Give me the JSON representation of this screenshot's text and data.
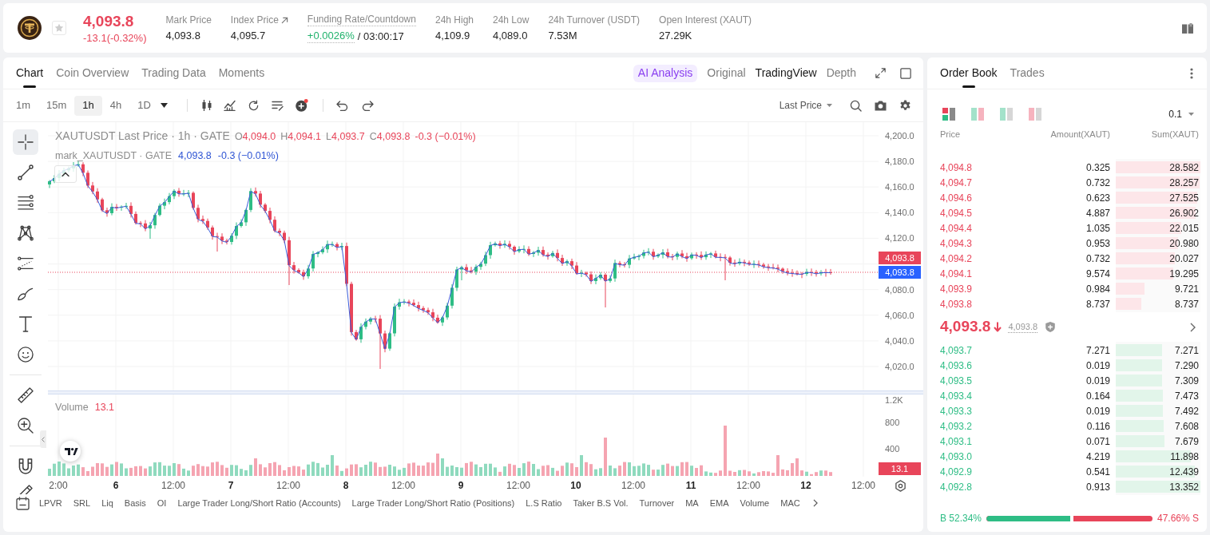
{
  "header": {
    "price": "4,093.8",
    "change": "-13.1(-0.32%)",
    "favorite": false,
    "stats": [
      {
        "label": "Mark Price",
        "value": "4,093.8",
        "kind": "plain"
      },
      {
        "label": "Index Price",
        "value": "4,095.7",
        "kind": "link"
      },
      {
        "label": "Funding Rate/Countdown",
        "value": "+0.0026%",
        "extra": "/ 03:00:17",
        "kind": "funding"
      },
      {
        "label": "24h High",
        "value": "4,109.9",
        "kind": "plain"
      },
      {
        "label": "24h Low",
        "value": "4,089.0",
        "kind": "plain"
      },
      {
        "label": "24h Turnover (USDT)",
        "value": "7.53M",
        "kind": "plain"
      },
      {
        "label": "Open Interest (XAUT)",
        "value": "27.29K",
        "kind": "plain"
      }
    ]
  },
  "chart_panel": {
    "tabs": [
      {
        "label": "Chart",
        "selected": true
      },
      {
        "label": "Coin Overview",
        "selected": false
      },
      {
        "label": "Trading Data",
        "selected": false
      },
      {
        "label": "Moments",
        "selected": false
      }
    ],
    "views": [
      {
        "label": "AI Analysis",
        "kind": "ai",
        "selected": false
      },
      {
        "label": "Original",
        "kind": "plain",
        "selected": false
      },
      {
        "label": "TradingView",
        "kind": "plain",
        "selected": true
      },
      {
        "label": "Depth",
        "kind": "plain",
        "selected": false
      }
    ],
    "intervals": [
      {
        "label": "1m",
        "selected": false
      },
      {
        "label": "15m",
        "selected": false
      },
      {
        "label": "1h",
        "selected": true
      },
      {
        "label": "4h",
        "selected": false
      },
      {
        "label": "1D",
        "selected": false
      }
    ],
    "price_source": "Last Price",
    "tool_groups": [
      [
        {
          "kind": "crosshair",
          "selected": true
        },
        {
          "kind": "line",
          "selected": false
        },
        {
          "kind": "hlines",
          "selected": false
        },
        {
          "kind": "pattern",
          "selected": false
        },
        {
          "kind": "channel",
          "selected": false
        },
        {
          "kind": "brush",
          "selected": false
        },
        {
          "kind": "text",
          "selected": false
        },
        {
          "kind": "emoji",
          "selected": false
        }
      ],
      [
        {
          "kind": "ruler",
          "selected": false
        },
        {
          "kind": "zoom",
          "selected": false
        }
      ],
      [
        {
          "kind": "magnet",
          "selected": false
        },
        {
          "kind": "pencil",
          "selected": false
        }
      ]
    ],
    "legend": {
      "title": "XAUTUSDT Last Price · 1h · GATE",
      "ohlc": [
        {
          "key": "O",
          "value": "4,094.0"
        },
        {
          "key": "H",
          "value": "4,094.1"
        },
        {
          "key": "L",
          "value": "4,093.7"
        },
        {
          "key": "C",
          "value": "4,093.8"
        }
      ],
      "change": "-0.3 (−0.01%)",
      "mark_title": "mark_XAUTUSDT · GATE",
      "mark_value": "4,093.8",
      "mark_change": "-0.3 (−0.01%)"
    },
    "price_axis": {
      "upper": [
        "4,200.0",
        "4,180.0",
        "4,160.0",
        "4,140.0",
        "4,120.0"
      ],
      "lower": [
        "4,080.0",
        "4,060.0",
        "4,040.0",
        "4,020.0"
      ]
    },
    "price_tags": [
      {
        "text": "4,093.8",
        "kind": "last"
      },
      {
        "text": "4,093.8",
        "kind": "mark"
      }
    ],
    "volume": {
      "label": "Volume",
      "value": "13.1",
      "axis": [
        "1.2K",
        "800",
        "400"
      ],
      "tag": "13.1"
    },
    "time_axis": [
      {
        "label": "2:00",
        "kind": "time"
      },
      {
        "label": "6",
        "kind": "day"
      },
      {
        "label": "12:00",
        "kind": "time"
      },
      {
        "label": "7",
        "kind": "day"
      },
      {
        "label": "12:00",
        "kind": "time"
      },
      {
        "label": "8",
        "kind": "day"
      },
      {
        "label": "12:00",
        "kind": "time"
      },
      {
        "label": "9",
        "kind": "day"
      },
      {
        "label": "12:00",
        "kind": "time"
      },
      {
        "label": "10",
        "kind": "day"
      },
      {
        "label": "12:00",
        "kind": "time"
      },
      {
        "label": "11",
        "kind": "day"
      },
      {
        "label": "12:00",
        "kind": "time"
      },
      {
        "label": "12",
        "kind": "day"
      },
      {
        "label": "12:00",
        "kind": "time"
      }
    ],
    "indicators": [
      "LPVR",
      "SRL",
      "Liq",
      "Basis",
      "OI",
      "Large Trader Long/Short Ratio (Accounts)",
      "Large Trader Long/Short Ratio (Positions)",
      "L.S Ratio",
      "Taker B.S Vol.",
      "Turnover",
      "MA",
      "EMA",
      "Volume",
      "MAC"
    ]
  },
  "order_book": {
    "tabs": [
      {
        "label": "Order Book",
        "selected": true
      },
      {
        "label": "Trades",
        "selected": false
      }
    ],
    "layouts": [
      {
        "kind": "split",
        "selected": true
      },
      {
        "kind": "both",
        "selected": false
      },
      {
        "kind": "bids",
        "selected": false
      },
      {
        "kind": "asks",
        "selected": false
      }
    ],
    "precision": "0.1",
    "columns": [
      "Price",
      "Amount(XAUT)",
      "Sum(XAUT)"
    ],
    "asks": [
      {
        "price": "4,094.8",
        "amount": "0.325",
        "sum": "28.582",
        "level": 1
      },
      {
        "price": "4,094.7",
        "amount": "0.732",
        "sum": "28.257",
        "level": 0.989
      },
      {
        "price": "4,094.6",
        "amount": "0.623",
        "sum": "27.525",
        "level": 0.963
      },
      {
        "price": "4,094.5",
        "amount": "4.887",
        "sum": "26.902",
        "level": 0.941
      },
      {
        "price": "4,094.4",
        "amount": "1.035",
        "sum": "22.015",
        "level": 0.77
      },
      {
        "price": "4,094.3",
        "amount": "0.953",
        "sum": "20.980",
        "level": 0.734
      },
      {
        "price": "4,094.2",
        "amount": "0.732",
        "sum": "20.027",
        "level": 0.701
      },
      {
        "price": "4,094.1",
        "amount": "9.574",
        "sum": "19.295",
        "level": 0.675
      },
      {
        "price": "4,093.9",
        "amount": "0.984",
        "sum": "9.721",
        "level": 0.34
      },
      {
        "price": "4,093.8",
        "amount": "8.737",
        "sum": "8.737",
        "level": 0.306
      }
    ],
    "mid": {
      "price": "4,093.8",
      "falling": true,
      "mark": "4,093.8"
    },
    "bids": [
      {
        "price": "4,093.7",
        "amount": "7.271",
        "sum": "7.271",
        "level": 0.545
      },
      {
        "price": "4,093.6",
        "amount": "0.019",
        "sum": "7.290",
        "level": 0.546
      },
      {
        "price": "4,093.5",
        "amount": "0.019",
        "sum": "7.309",
        "level": 0.547
      },
      {
        "price": "4,093.4",
        "amount": "0.164",
        "sum": "7.473",
        "level": 0.56
      },
      {
        "price": "4,093.3",
        "amount": "0.019",
        "sum": "7.492",
        "level": 0.561
      },
      {
        "price": "4,093.2",
        "amount": "0.116",
        "sum": "7.608",
        "level": 0.57
      },
      {
        "price": "4,093.1",
        "amount": "0.071",
        "sum": "7.679",
        "level": 0.575
      },
      {
        "price": "4,093.0",
        "amount": "4.219",
        "sum": "11.898",
        "level": 0.891
      },
      {
        "price": "4,092.9",
        "amount": "0.541",
        "sum": "12.439",
        "level": 0.932
      },
      {
        "price": "4,092.8",
        "amount": "0.913",
        "sum": "13.352",
        "level": 1
      }
    ],
    "ratio": {
      "buy": "B 52.34%",
      "sell": "47.66% S",
      "level": 0.5234
    }
  }
}
